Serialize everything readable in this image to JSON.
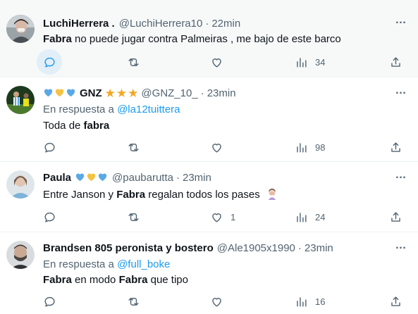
{
  "tweets": [
    {
      "name": "LuchiHerrera .",
      "handle": "@LuchiHerrera10",
      "dot": "·",
      "time": "22min",
      "text_bold": "Fabra",
      "text_rest": " no puede jugar contra Palmeiras , me bajo de este barco",
      "views": "34"
    },
    {
      "name": "GNZ",
      "handle": "@GNZ_10_",
      "dot": "·",
      "time": "23min",
      "reply_prefix": "En respuesta a ",
      "reply_handle": "@la12tuittera",
      "text_pre": "Toda de ",
      "text_bold": "fabra",
      "likes": "",
      "views": "98"
    },
    {
      "name": "Paula",
      "handle": "@paubarutta",
      "dot": "·",
      "time": "23min",
      "text_pre": "Entre Janson y ",
      "text_bold": "Fabra",
      "text_rest": " regalan todos los pases",
      "likes": "1",
      "views": "24"
    },
    {
      "name": "Brandsen 805 peronista y bostero",
      "handle": "@Ale1905x1990",
      "dot": "·",
      "time": "23min",
      "reply_prefix": "En respuesta a ",
      "reply_handle": "@full_boke",
      "text_bold1": "Fabra",
      "text_mid": " en modo ",
      "text_bold2": "Fabra",
      "text_rest": " que tipo",
      "views": "16"
    }
  ],
  "colors": {
    "link": "#1d9bf0",
    "secondary": "#536471",
    "heart_blue": "#5aa9e6",
    "heart_yellow": "#f5c242",
    "star": "#f4a623"
  },
  "more_icon": "…"
}
